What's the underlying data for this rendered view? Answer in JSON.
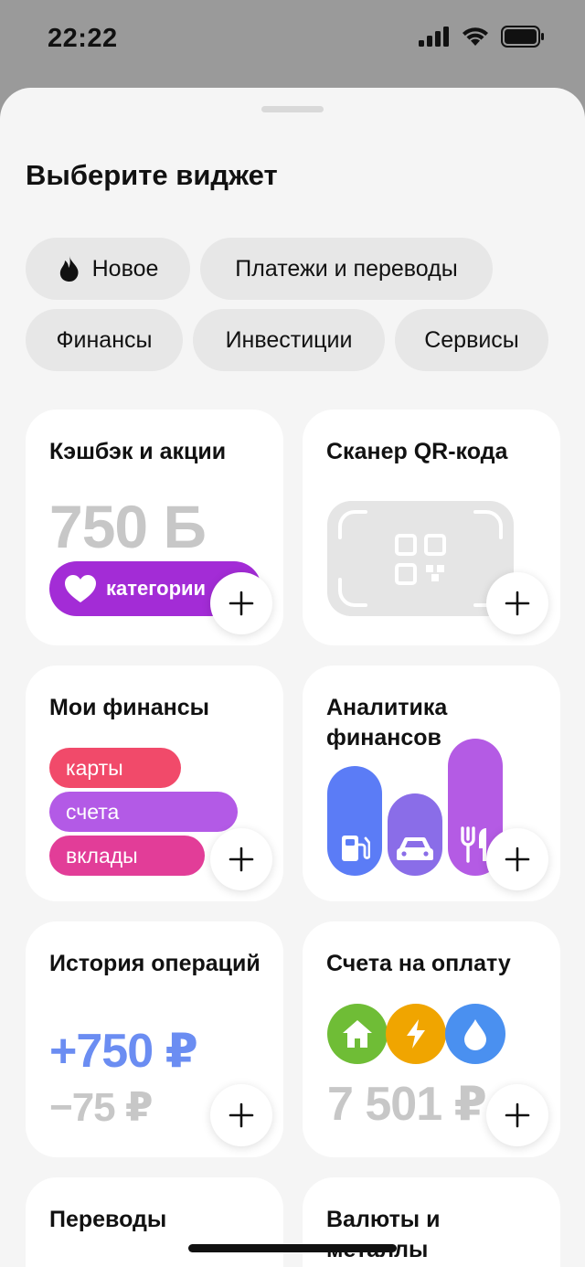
{
  "status_bar": {
    "time": "22:22"
  },
  "sheet": {
    "title": "Выберите виджет"
  },
  "chips": [
    {
      "label": "Новое",
      "icon": "fire-icon"
    },
    {
      "label": "Платежи и переводы"
    },
    {
      "label": "Финансы"
    },
    {
      "label": "Инвестиции"
    },
    {
      "label": "Сервисы"
    }
  ],
  "widgets": {
    "cashback": {
      "title": "Кэшбэк и акции",
      "points": "750 Б",
      "pill_label": "категории",
      "pill_color": "#a32cd6"
    },
    "qr": {
      "title": "Сканер QR-кода"
    },
    "finances": {
      "title": "Мои финансы",
      "items": [
        "карты",
        "счета",
        "вклады"
      ],
      "colors": [
        "#f14a6a",
        "#b35ae6",
        "#e23d98"
      ]
    },
    "analytics": {
      "title": "Аналитика финансов",
      "category_icons": [
        "fuel-icon",
        "car-icon",
        "food-icon"
      ],
      "colors": [
        "#5b7cf6",
        "#8a6de8",
        "#b45be4"
      ]
    },
    "history": {
      "title": "История операций",
      "income": "+750 ₽",
      "expense": "−75 ₽",
      "income_color": "#6b8df2"
    },
    "bills": {
      "title": "Счета на оплату",
      "amount": "7 501 ₽",
      "category_icons": [
        "house-icon",
        "lightning-icon",
        "drop-icon"
      ],
      "colors": [
        "#6fbd36",
        "#f0a500",
        "#4a90f0"
      ]
    },
    "transfers": {
      "title": "Переводы"
    },
    "currency": {
      "title": "Валюты и металлы"
    }
  }
}
